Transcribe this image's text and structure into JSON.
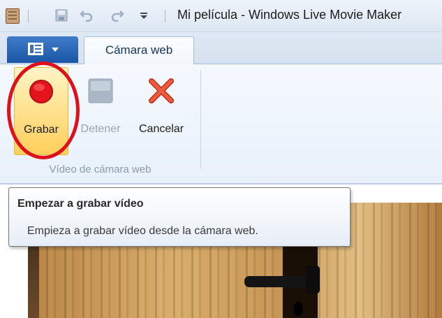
{
  "window": {
    "title": "Mi película - Windows Live Movie Maker",
    "app_icon": "film-strip-icon"
  },
  "quick_access": [
    {
      "icon": "save-icon"
    },
    {
      "icon": "undo-icon"
    },
    {
      "icon": "redo-icon"
    },
    {
      "icon": "customize-dropdown-icon"
    }
  ],
  "ribbon": {
    "app_menu_icon": "application-menu-icon",
    "active_tab": "Cámara web",
    "buttons": {
      "record_label": "Grabar",
      "stop_label": "Detener",
      "cancel_label": "Cancelar"
    },
    "group_label": "Vídeo de cámara web"
  },
  "tooltip": {
    "title": "Empezar a grabar vídeo",
    "description": "Empieza a grabar vídeo desde la cámara web."
  },
  "colors": {
    "record_accent": "#e0101a",
    "record_highlight": "#ffe394",
    "app_menu": "#1c56a6",
    "disabled_text": "#9aa6b3"
  }
}
